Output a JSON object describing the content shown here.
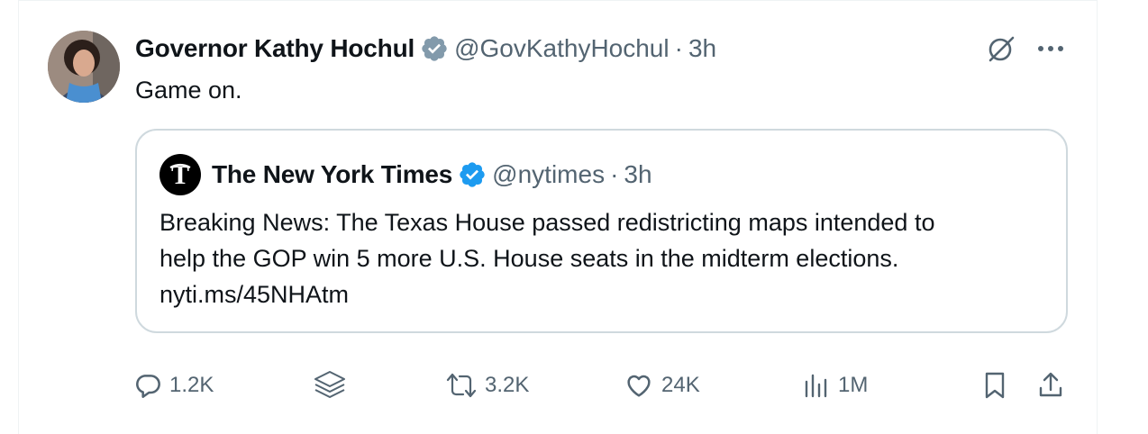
{
  "tweet": {
    "author_name": "Governor Kathy Hochul",
    "author_handle": "@GovKathyHochul",
    "separator": "·",
    "time": "3h",
    "text": "Game on.",
    "verified_color": "#829aab"
  },
  "quote": {
    "author_name": "The New York Times",
    "author_handle": "@nytimes",
    "separator": "·",
    "time": "3h",
    "lines": [
      "Breaking News: The Texas House passed redistricting maps intended to",
      "help the GOP win 5 more U.S. House seats in the midterm elections.",
      "nyti.ms/45NHAtm"
    ],
    "verified_color": "#1d9bf0"
  },
  "actions": {
    "replies": "1.2K",
    "reposts": "3.2K",
    "likes": "24K",
    "views": "1M"
  },
  "icons": {
    "grok": "grok-icon",
    "more": "more-icon",
    "reply": "reply-icon",
    "stack": "stack-icon",
    "repost": "repost-icon",
    "like": "heart-icon",
    "views": "views-icon",
    "bookmark": "bookmark-icon",
    "share": "share-icon"
  }
}
